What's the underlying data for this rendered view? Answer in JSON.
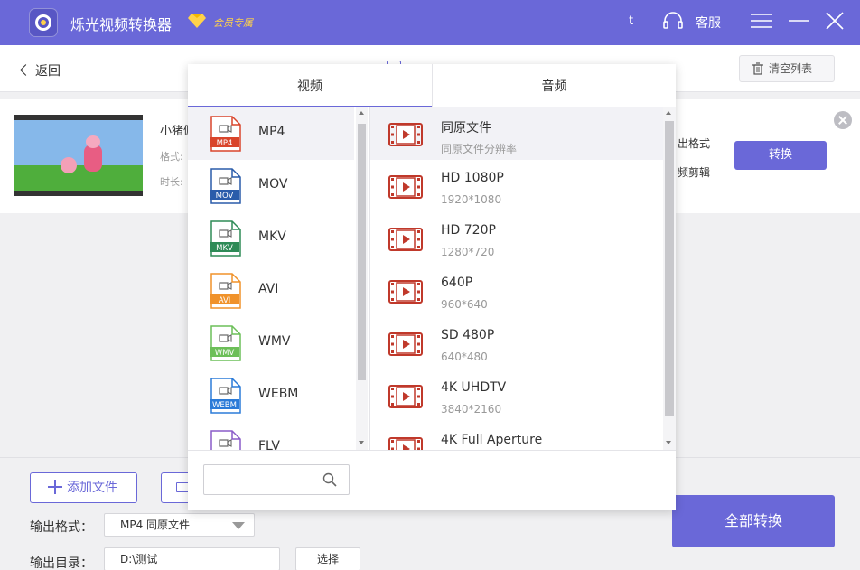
{
  "app": {
    "title": "烁光视频转换器",
    "vip_label": "会员专属",
    "user_initial": "t",
    "support_label": "客服"
  },
  "toolbar": {
    "back_label": "返回",
    "clear_label": "清空列表"
  },
  "file": {
    "name": "小猪佩",
    "format_label": "格式:",
    "duration_label": "时长:",
    "output_format_label": "出格式",
    "edit_label": "频剪辑",
    "convert_label": "转换"
  },
  "popup": {
    "tabs": [
      {
        "label": "视频"
      },
      {
        "label": "音频"
      }
    ],
    "formats": [
      {
        "name": "MP4",
        "badge": "MP4",
        "color": "#d9452b"
      },
      {
        "name": "MOV",
        "badge": "MOV",
        "color": "#2a5caa"
      },
      {
        "name": "MKV",
        "badge": "MKV",
        "color": "#2e8b57"
      },
      {
        "name": "AVI",
        "badge": "AVI",
        "color": "#f0922a"
      },
      {
        "name": "WMV",
        "badge": "WMV",
        "color": "#6cbf58"
      },
      {
        "name": "WEBM",
        "badge": "WEBM",
        "color": "#2b7bd8"
      },
      {
        "name": "FLV",
        "badge": "FLV",
        "color": "#8a5cc8"
      }
    ],
    "resolutions": [
      {
        "name": "同原文件",
        "sub": "同原文件分辨率"
      },
      {
        "name": "HD 1080P",
        "sub": "1920*1080"
      },
      {
        "name": "HD 720P",
        "sub": "1280*720"
      },
      {
        "name": "640P",
        "sub": "960*640"
      },
      {
        "name": "SD 480P",
        "sub": "640*480"
      },
      {
        "name": "4K UHDTV",
        "sub": "3840*2160"
      },
      {
        "name": "4K Full Aperture",
        "sub": ""
      }
    ],
    "search_placeholder": ""
  },
  "bottom": {
    "add_file_label": "添加文件",
    "output_format_label": "输出格式：",
    "output_format_value": "MP4 同原文件",
    "output_dir_label": "输出目录：",
    "output_dir_value": "D:\\测试",
    "choose_label": "选择",
    "convert_all_label": "全部转换"
  },
  "colors": {
    "brand": "#6a68d8",
    "vip_gold": "#ffd24a",
    "film_icon": "#c0392b"
  },
  "icons": [
    "app-logo-icon",
    "vip-diamond-icon",
    "headset-icon",
    "menu-icon",
    "minimize-icon",
    "close-icon",
    "trash-icon",
    "remove-icon",
    "plus-icon",
    "folder-icon",
    "search-icon",
    "film-icon",
    "file-format-icon"
  ]
}
